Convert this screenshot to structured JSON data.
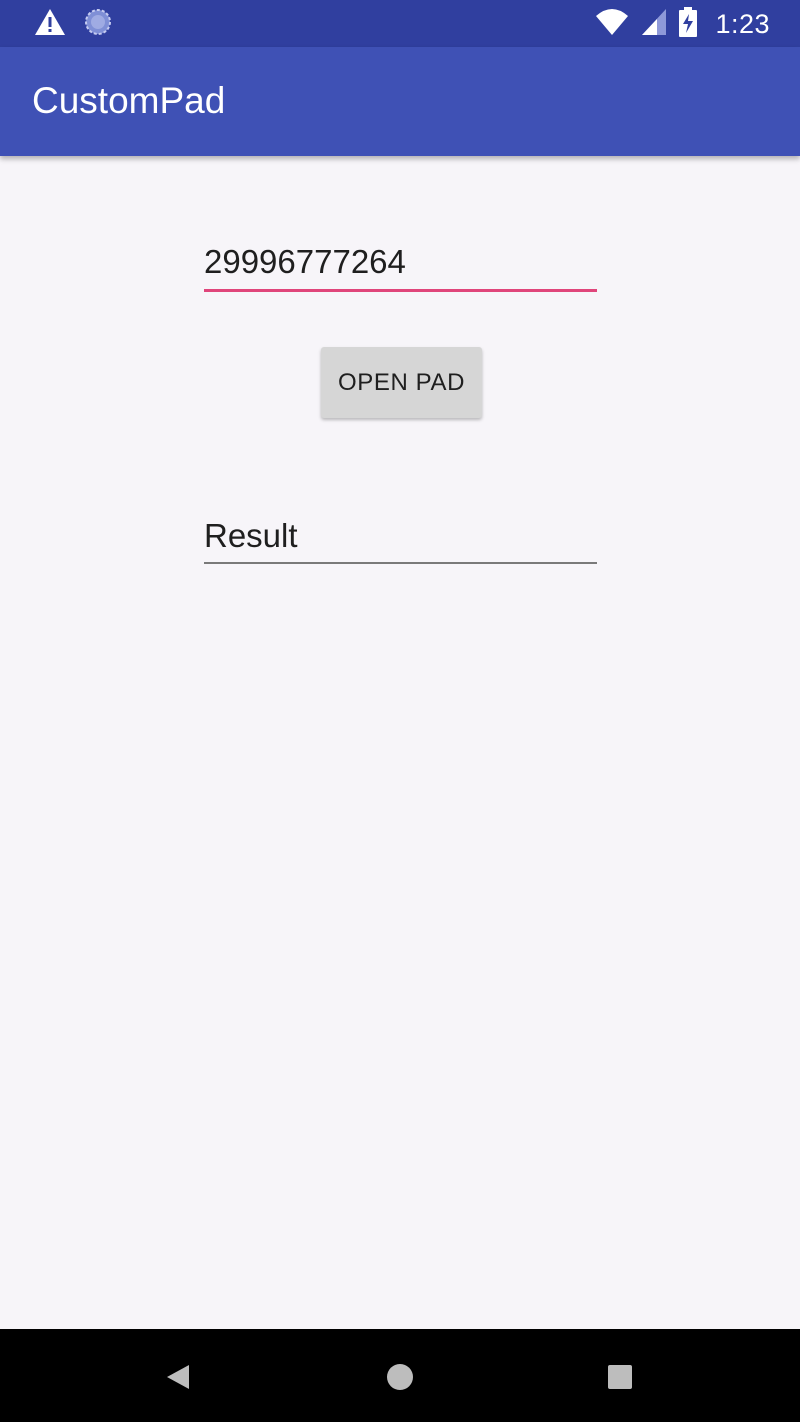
{
  "status_bar": {
    "time": "1:23",
    "icons": [
      "warning-icon",
      "sync-icon",
      "wifi-icon",
      "signal-icon",
      "battery-charging-icon"
    ]
  },
  "app_bar": {
    "title": "CustomPad"
  },
  "main": {
    "number_input": {
      "value": "29996777264"
    },
    "open_pad_button": {
      "label": "OPEN PAD"
    },
    "result_field": {
      "value": "Result"
    }
  },
  "nav_bar": {
    "buttons": [
      "back-icon",
      "home-icon",
      "recents-icon"
    ]
  },
  "colors": {
    "status_bar": "#303f9f",
    "app_bar": "#3f51b5",
    "accent": "#e0457b",
    "background": "#f7f5f9"
  }
}
